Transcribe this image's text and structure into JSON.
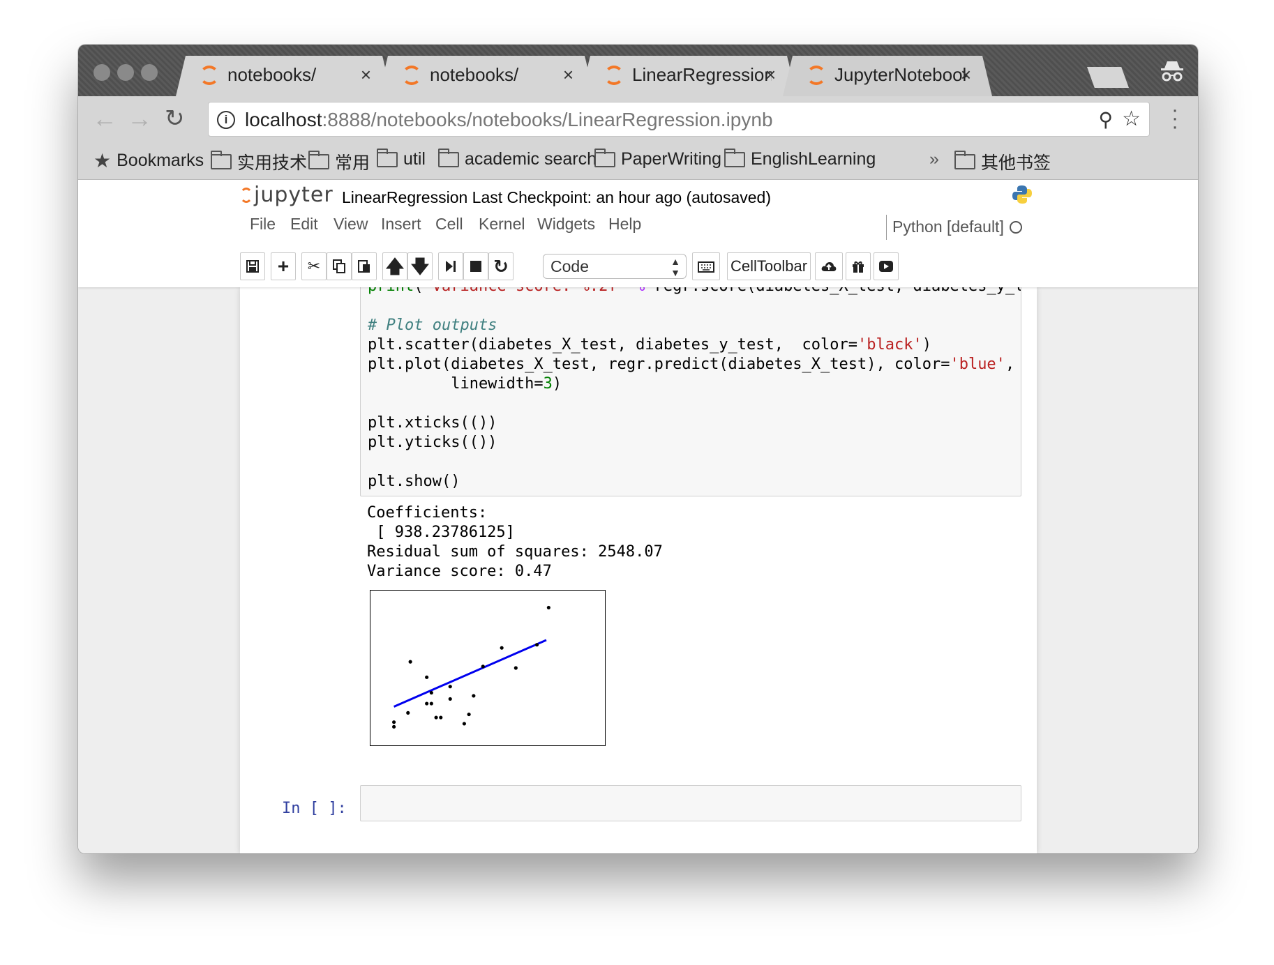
{
  "browser": {
    "tabs": [
      {
        "title": "notebooks/"
      },
      {
        "title": "notebooks/"
      },
      {
        "title": "LinearRegression"
      },
      {
        "title": "JupyterNotebookT"
      }
    ],
    "close_glyph": "×",
    "url_host": "localhost",
    "url_rest": ":8888/notebooks/notebooks/LinearRegression.ipynb",
    "bookmarks_label": "Bookmarks",
    "bookmark_folders": [
      "实用技术",
      "常用",
      "util",
      "academic search",
      "PaperWriting",
      "EnglishLearning"
    ],
    "overflow": "»",
    "other_bookmarks": "其他书签"
  },
  "jupyter": {
    "logo": "jupyter",
    "notebook_name": "LinearRegression",
    "checkpoint": "Last Checkpoint: an hour ago (autosaved)",
    "menu": [
      "File",
      "Edit",
      "View",
      "Insert",
      "Cell",
      "Kernel",
      "Widgets",
      "Help"
    ],
    "kernel": "Python [default]",
    "cell_type": "Code",
    "celltoolbar": "CellToolbar",
    "prompt": "In [ ]:"
  },
  "output": {
    "lines": [
      "Coefficients:",
      " [ 938.23786125]",
      "Residual sum of squares: 2548.07",
      "Variance score: 0.47"
    ]
  },
  "chart_data": {
    "type": "scatter",
    "title": "",
    "xlabel": "",
    "ylabel": "",
    "xticks": [],
    "yticks": [],
    "points": [
      [
        0.1,
        0.12
      ],
      [
        0.1,
        0.15
      ],
      [
        0.16,
        0.21
      ],
      [
        0.17,
        0.54
      ],
      [
        0.24,
        0.27
      ],
      [
        0.24,
        0.44
      ],
      [
        0.26,
        0.27
      ],
      [
        0.26,
        0.34
      ],
      [
        0.28,
        0.18
      ],
      [
        0.3,
        0.18
      ],
      [
        0.34,
        0.3
      ],
      [
        0.34,
        0.38
      ],
      [
        0.4,
        0.14
      ],
      [
        0.42,
        0.2
      ],
      [
        0.44,
        0.32
      ],
      [
        0.48,
        0.51
      ],
      [
        0.56,
        0.63
      ],
      [
        0.62,
        0.5
      ],
      [
        0.71,
        0.65
      ],
      [
        0.76,
        0.89
      ]
    ],
    "points_color": "#000000",
    "fit_line": {
      "x": [
        0.1,
        0.75
      ],
      "y": [
        0.25,
        0.68
      ],
      "color": "#0000ee"
    }
  }
}
